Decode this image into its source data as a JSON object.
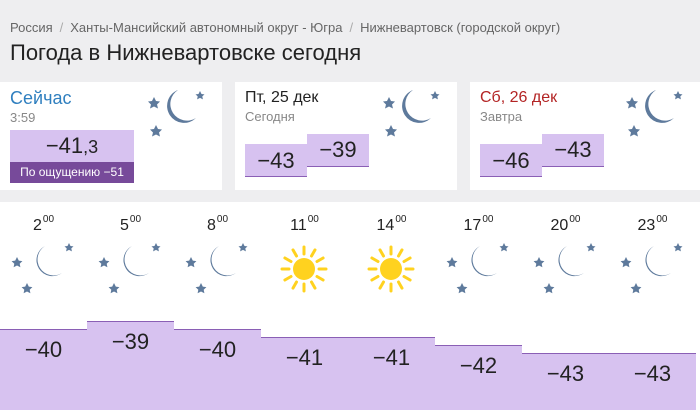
{
  "breadcrumb": [
    "Россия",
    "Ханты-Мансийский автономный округ - Югра",
    "Нижневартовск (городской округ)"
  ],
  "page_title": "Погода в Нижневартовске сегодня",
  "now": {
    "label": "Сейчас",
    "time": "3:59",
    "temp_int": "−41",
    "temp_dec": ",3",
    "feels_like": "По ощущению −51",
    "icon": "night-clear-moon-stars-icon"
  },
  "days": [
    {
      "date": "Пт, 25 дек",
      "sub": "Сегодня",
      "night": "−43",
      "day": "−39",
      "date_color": "#222222",
      "icon": "night-clear-moon-stars-icon"
    },
    {
      "date": "Сб, 26 дек",
      "sub": "Завтра",
      "night": "−46",
      "day": "−43",
      "date_color": "#b32424",
      "icon": "night-clear-moon-stars-icon"
    }
  ],
  "hourly": [
    {
      "hour": "2",
      "min": "00",
      "temp": "−40",
      "value": -40,
      "icon": "moon"
    },
    {
      "hour": "5",
      "min": "00",
      "temp": "−39",
      "value": -39,
      "icon": "moon"
    },
    {
      "hour": "8",
      "min": "00",
      "temp": "−40",
      "value": -40,
      "icon": "moon"
    },
    {
      "hour": "11",
      "min": "00",
      "temp": "−41",
      "value": -41,
      "icon": "sun"
    },
    {
      "hour": "14",
      "min": "00",
      "temp": "−41",
      "value": -41,
      "icon": "sun"
    },
    {
      "hour": "17",
      "min": "00",
      "temp": "−42",
      "value": -42,
      "icon": "moon"
    },
    {
      "hour": "20",
      "min": "00",
      "temp": "−43",
      "value": -43,
      "icon": "moon"
    },
    {
      "hour": "23",
      "min": "00",
      "temp": "−43",
      "value": -43,
      "icon": "moon"
    }
  ],
  "colors": {
    "accent_blue": "#2f7fbf",
    "temp_bar": "#d7c2f0",
    "feels_bar": "#774a9a",
    "saturday_red": "#b32424",
    "moon": "#5e7a9c",
    "sun": "#ffd21f"
  }
}
